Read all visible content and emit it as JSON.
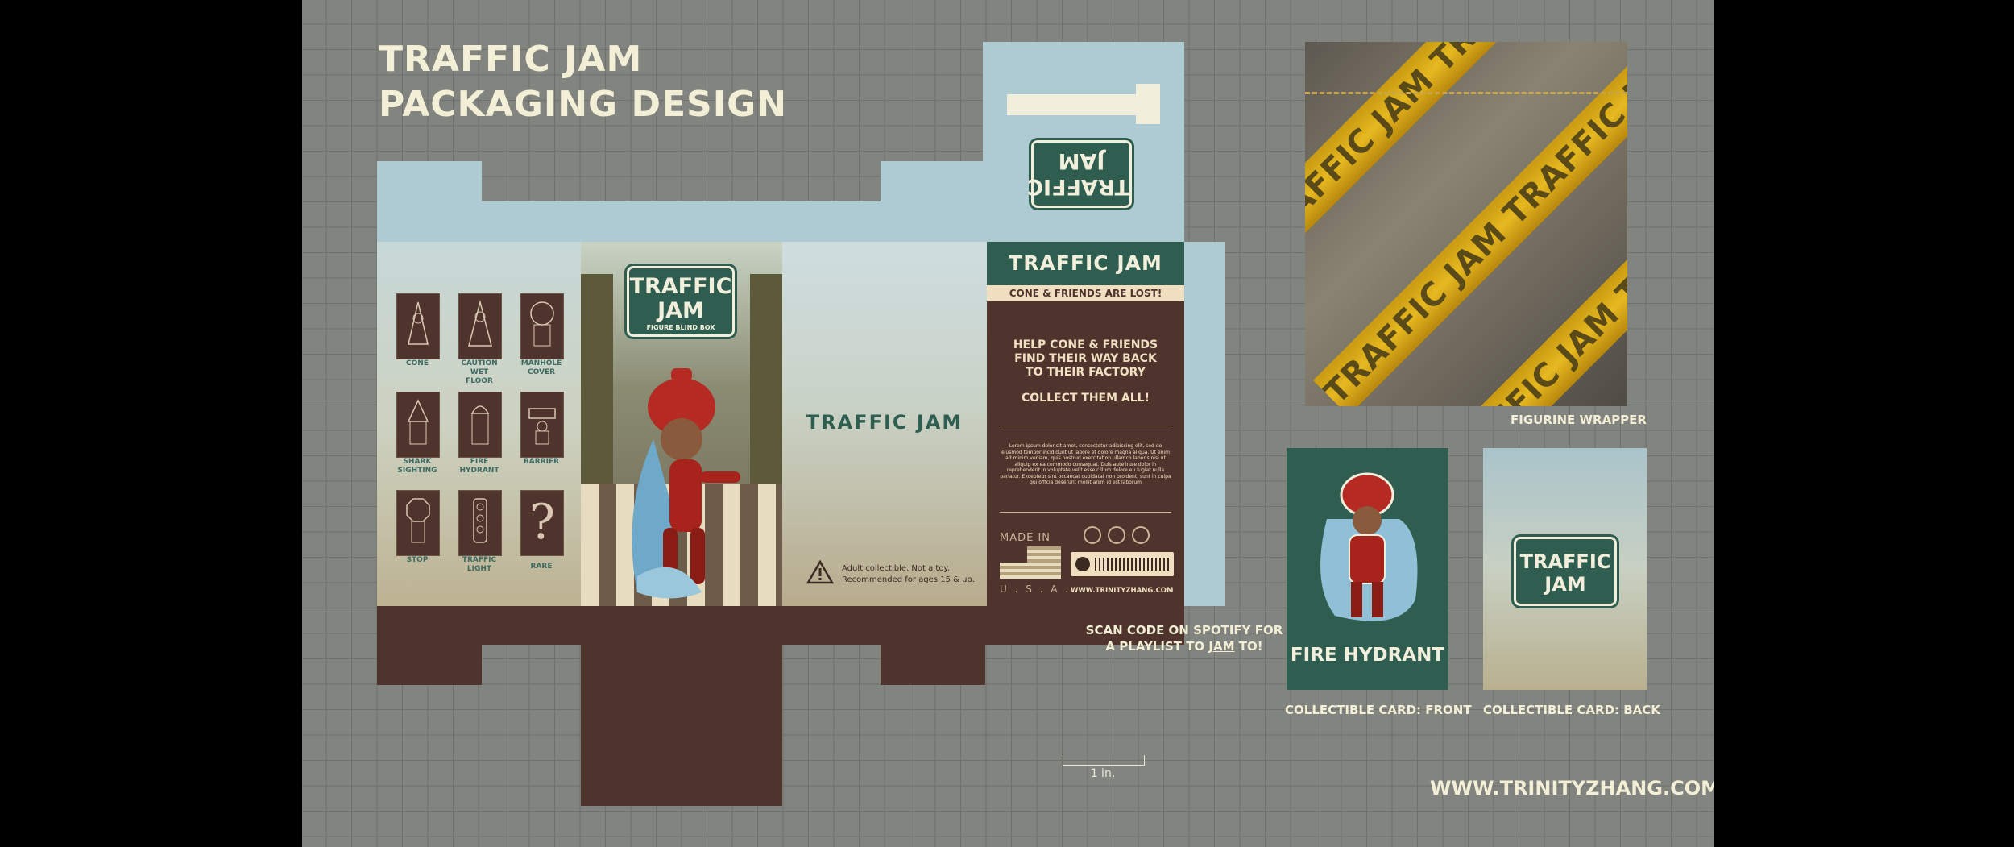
{
  "title": {
    "line1": "TRAFFIC JAM",
    "line2": "PACKAGING DESIGN"
  },
  "characters": [
    {
      "label": "CONE"
    },
    {
      "label": "CAUTION\nWET\nFLOOR"
    },
    {
      "label": "MANHOLE\nCOVER"
    },
    {
      "label": "SHARK\nSIGHTING"
    },
    {
      "label": "FIRE\nHYDRANT"
    },
    {
      "label": "BARRIER"
    },
    {
      "label": "STOP"
    },
    {
      "label": "TRAFFIC\nLIGHT"
    },
    {
      "label": "RARE"
    }
  ],
  "front": {
    "logo_line1": "TRAFFIC",
    "logo_line2": "JAM",
    "subtitle": "FIGURE BLIND BOX"
  },
  "side": {
    "brand": "TRAFFIC JAM",
    "warning_line1": "Adult collectible. Not a toy.",
    "warning_line2": "Recommended for ages 15 & up."
  },
  "top_flap": {
    "logo_line1": "TRAFFIC",
    "logo_line2": "JAM"
  },
  "back": {
    "header": "TRAFFIC JAM",
    "tagline": "CONE & FRIENDS ARE LOST!",
    "help_line1": "HELP CONE & FRIENDS",
    "help_line2": "FIND THEIR WAY BACK",
    "help_line3": "TO THEIR FACTORY",
    "collect": "COLLECT THEM ALL!",
    "lorem": "Lorem ipsum dolor sit amet, consectetur adipiscing elit, sed do eiusmod tempor incididunt ut labore et dolore magna aliqua. Ut enim ad minim veniam, quis nostrud exercitation ullamco laboris nisi ut aliquip ex ea commodo consequat. Duis aute irure dolor in reprehenderit in voluptate velit esse cillum dolore eu fugiat nulla pariatur. Excepteur sint occaecat cupidatat non proident, sunt in culpa qui officia deserunt mollit anim id est laborum",
    "made_in": "MADE IN",
    "usa": "U . S . A .",
    "website": "WWW.TRINITYZHANG.COM"
  },
  "spotify_note": {
    "line1": "SCAN CODE ON SPOTIFY FOR",
    "line2_pre": "A PLAYLIST TO ",
    "line2_link": "JAM",
    "line2_post": " TO!"
  },
  "scale_label": "1 in.",
  "wrapper": {
    "stripe_text": "TRAFFIC JAM TRAFFIC JAM TRAFFIC JAM",
    "label": "FIGURINE WRAPPER"
  },
  "card_front": {
    "name": "FIRE HYDRANT",
    "label": "COLLECTIBLE CARD: FRONT"
  },
  "card_back": {
    "logo_line1": "TRAFFIC",
    "logo_line2": "JAM",
    "label": "COLLECTIBLE CARD: BACK"
  },
  "site": "WWW.TRINITYZHANG.COM",
  "colors": {
    "grid_bg": "#828480",
    "brand_green": "#2f5e51",
    "brown": "#4e342c",
    "light_blue": "#aecbd4",
    "cream": "#f2efd6",
    "tape_yellow": "#e6b820"
  }
}
